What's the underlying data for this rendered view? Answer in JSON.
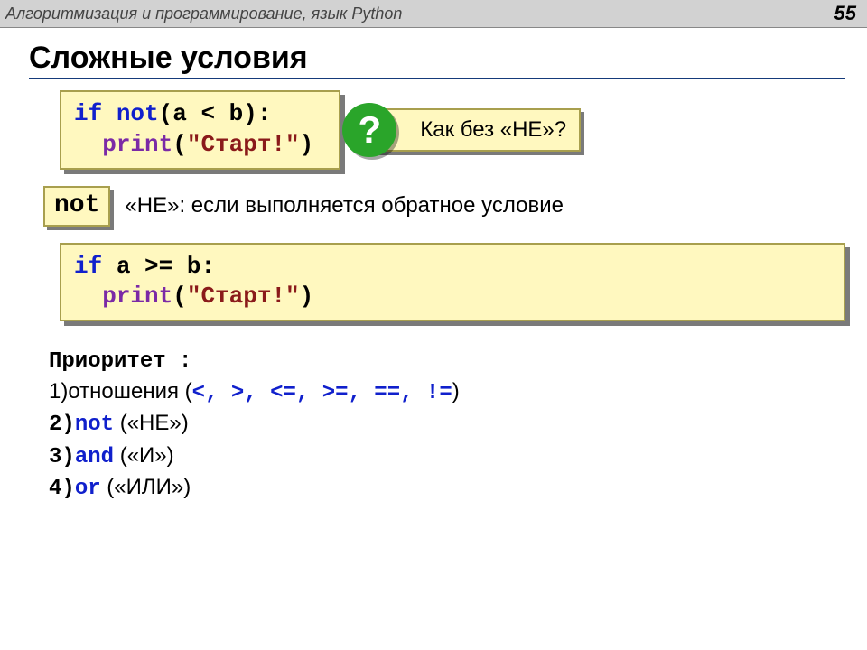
{
  "topbar": {
    "title": "Алгоритмизация и программирование, язык Python",
    "page": "55"
  },
  "heading": "Сложные условия",
  "code1": {
    "if": "if",
    "not": "not",
    "expr_open": "(a < b)",
    "colon": ":",
    "indent": "  ",
    "print": "print",
    "args_open": "(",
    "str": "\"Старт!\"",
    "args_close": ")"
  },
  "ask": {
    "question_mark": "?",
    "text": "Как без «НЕ»?"
  },
  "definition": {
    "tag": "not",
    "text": "«НЕ»: если выполняется обратное условие"
  },
  "code2": {
    "if": "if",
    "expr": " a >= b",
    "colon": ":",
    "indent": "  ",
    "print": "print",
    "args_open": "(",
    "str": "\"Старт!\"",
    "args_close": ")"
  },
  "priority": {
    "title": "Приоритет :",
    "l1_a": "1)отношения (",
    "l1_ops": "<, >, <=, >=, ==, !=",
    "l1_b": ")",
    "l2_num": "2)",
    "l2_kw": "not",
    "l2_txt": " («НЕ»)",
    "l3_num": "3)",
    "l3_kw": "and",
    "l3_txt": " («И»)",
    "l4_num": "4)",
    "l4_kw": "or",
    "l4_txt": " («ИЛИ»)"
  }
}
